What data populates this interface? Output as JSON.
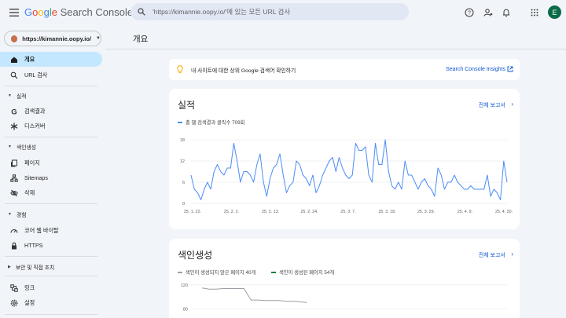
{
  "topbar": {
    "logo_google": [
      "G",
      "o",
      "o",
      "g",
      "l",
      "e"
    ],
    "logo_product": "Search Console",
    "search_placeholder": "'https://kimannie.oopy.io/'에 있는 모든 URL 검사",
    "avatar_letter": "E"
  },
  "sidebar": {
    "property": "https://kimannie.oopy.io/",
    "items": [
      {
        "label": "개요",
        "icon": "home-icon",
        "active": true
      },
      {
        "label": "URL 검사",
        "icon": "search-icon"
      }
    ],
    "sections": [
      {
        "label": "실적",
        "items": [
          {
            "label": "검색결과",
            "icon": "google-g-icon"
          },
          {
            "label": "디스커버",
            "icon": "asterisk-icon"
          }
        ]
      },
      {
        "label": "색인생성",
        "items": [
          {
            "label": "페이지",
            "icon": "pages-icon"
          },
          {
            "label": "Sitemaps",
            "icon": "sitemap-icon"
          },
          {
            "label": "삭제",
            "icon": "visibility-off-icon"
          }
        ]
      },
      {
        "label": "경험",
        "items": [
          {
            "label": "코어 웹 바이탈",
            "icon": "speed-icon"
          },
          {
            "label": "HTTPS",
            "icon": "lock-icon"
          }
        ]
      },
      {
        "label": "보안 및 직접 조치",
        "items": []
      }
    ],
    "bottom": [
      {
        "label": "링크",
        "icon": "links-icon"
      },
      {
        "label": "설정",
        "icon": "settings-icon"
      }
    ]
  },
  "main": {
    "title": "개요",
    "insights_text": "내 사이트에 대한 상위 Google 검색어 확인하기",
    "insights_link": "Search Console Insights",
    "performance": {
      "title": "실적",
      "link": "전체 보고서",
      "legend": "총 웹 검색결과 클릭수 709회"
    },
    "indexing": {
      "title": "색인생성",
      "link": "전체 보고서",
      "legend_not_indexed": "색인이 생성되지 않은 페이지 40개",
      "legend_indexed": "색인이 생성된 페이지 54개"
    }
  },
  "colors": {
    "accent": "#0b57d0",
    "line": "#4c8df6",
    "indexed": "#0b8043",
    "not_indexed": "#9aa0a6"
  },
  "chart_data": [
    {
      "type": "line",
      "x_tick_labels": [
        "25. 1. 22.",
        "25. 2. 2.",
        "25. 2. 13.",
        "25. 2. 24.",
        "25. 3. 7.",
        "25. 3. 18.",
        "25. 3. 29.",
        "25. 4. 9.",
        "25. 4. 20."
      ],
      "yticks": [
        0,
        6,
        12,
        18
      ],
      "ylim": [
        0,
        18
      ],
      "series": [
        {
          "name": "총 웹 검색결과 클릭수 709회",
          "values": [
            8,
            4,
            3,
            1,
            4,
            6,
            4,
            9,
            11,
            9,
            8,
            10,
            10,
            17,
            12,
            6,
            9,
            9,
            8,
            6,
            11,
            14,
            6,
            2,
            7,
            10,
            11,
            14,
            8,
            3,
            5,
            6,
            12,
            11,
            8,
            7,
            5,
            8,
            3,
            5,
            8,
            10,
            12,
            13,
            9,
            13,
            10,
            8,
            7,
            8,
            17,
            15,
            15,
            16,
            8,
            6,
            17,
            11,
            11,
            18,
            9,
            5,
            4,
            6,
            4,
            12,
            8,
            8,
            6,
            4,
            6,
            7,
            5,
            4,
            2,
            10,
            8,
            4,
            6,
            6,
            8,
            6,
            5,
            4,
            4,
            5,
            4,
            4,
            4,
            4,
            8,
            2,
            4,
            3,
            1,
            12,
            6
          ]
        }
      ]
    },
    {
      "type": "line",
      "yticks": [
        80,
        120
      ],
      "ylim": [
        60,
        125
      ],
      "series": [
        {
          "name": "색인이 생성되지 않은 페이지 40개",
          "values": [
            115,
            113,
            113,
            114,
            114,
            114,
            114,
            95,
            95,
            94,
            94,
            94,
            93,
            93,
            92,
            91
          ]
        }
      ]
    }
  ]
}
